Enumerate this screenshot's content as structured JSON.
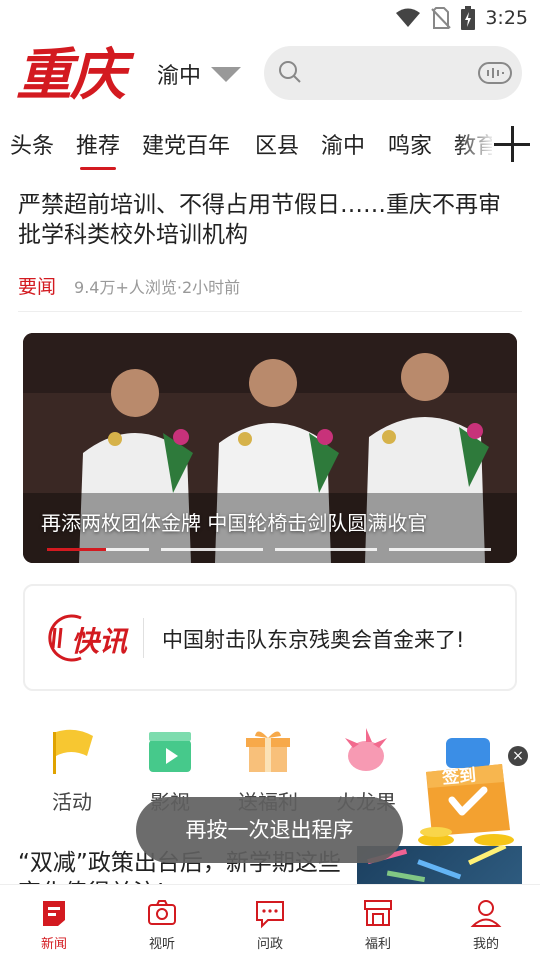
{
  "status": {
    "time": "3:25"
  },
  "header": {
    "logo_text": "重庆",
    "city": "渝中",
    "search_placeholder": ""
  },
  "tabs": [
    {
      "label": "头条"
    },
    {
      "label": "推荐",
      "active": true
    },
    {
      "label": "建党百年"
    },
    {
      "label": "区县"
    },
    {
      "label": "渝中"
    },
    {
      "label": "鸣家"
    },
    {
      "label": "教育"
    }
  ],
  "news1": {
    "title": "严禁超前培训、不得占用节假日……重庆不再审批学科类校外培训机构",
    "tag": "要闻",
    "meta": "9.4万+人浏览·2小时前"
  },
  "banner": {
    "caption": "再添两枚团体金牌 中国轮椅击剑队圆满收官",
    "slide_count": 4,
    "active_slide": 1
  },
  "flash": {
    "logo_text": "快讯",
    "text": "中国射击队东京残奥会首金来了!"
  },
  "quick_links": [
    {
      "label": "活动",
      "icon": "flag-icon"
    },
    {
      "label": "影视",
      "icon": "film-clapper-icon"
    },
    {
      "label": "送福利",
      "icon": "gift-icon"
    },
    {
      "label": "火龙果",
      "icon": "dragon-fruit-icon"
    }
  ],
  "promo": {
    "label": "签到",
    "close": "×"
  },
  "news2": {
    "title": "“双减”政策出台后，新学期这些变化值得关注!"
  },
  "toast": {
    "text": "再按一次退出程序"
  },
  "bottom_nav": [
    {
      "label": "新闻",
      "icon": "news-icon",
      "active": true
    },
    {
      "label": "视听",
      "icon": "camera-icon"
    },
    {
      "label": "问政",
      "icon": "message-icon"
    },
    {
      "label": "福利",
      "icon": "store-icon"
    },
    {
      "label": "我的",
      "icon": "user-icon"
    }
  ],
  "colors": {
    "accent": "#d31a20"
  }
}
